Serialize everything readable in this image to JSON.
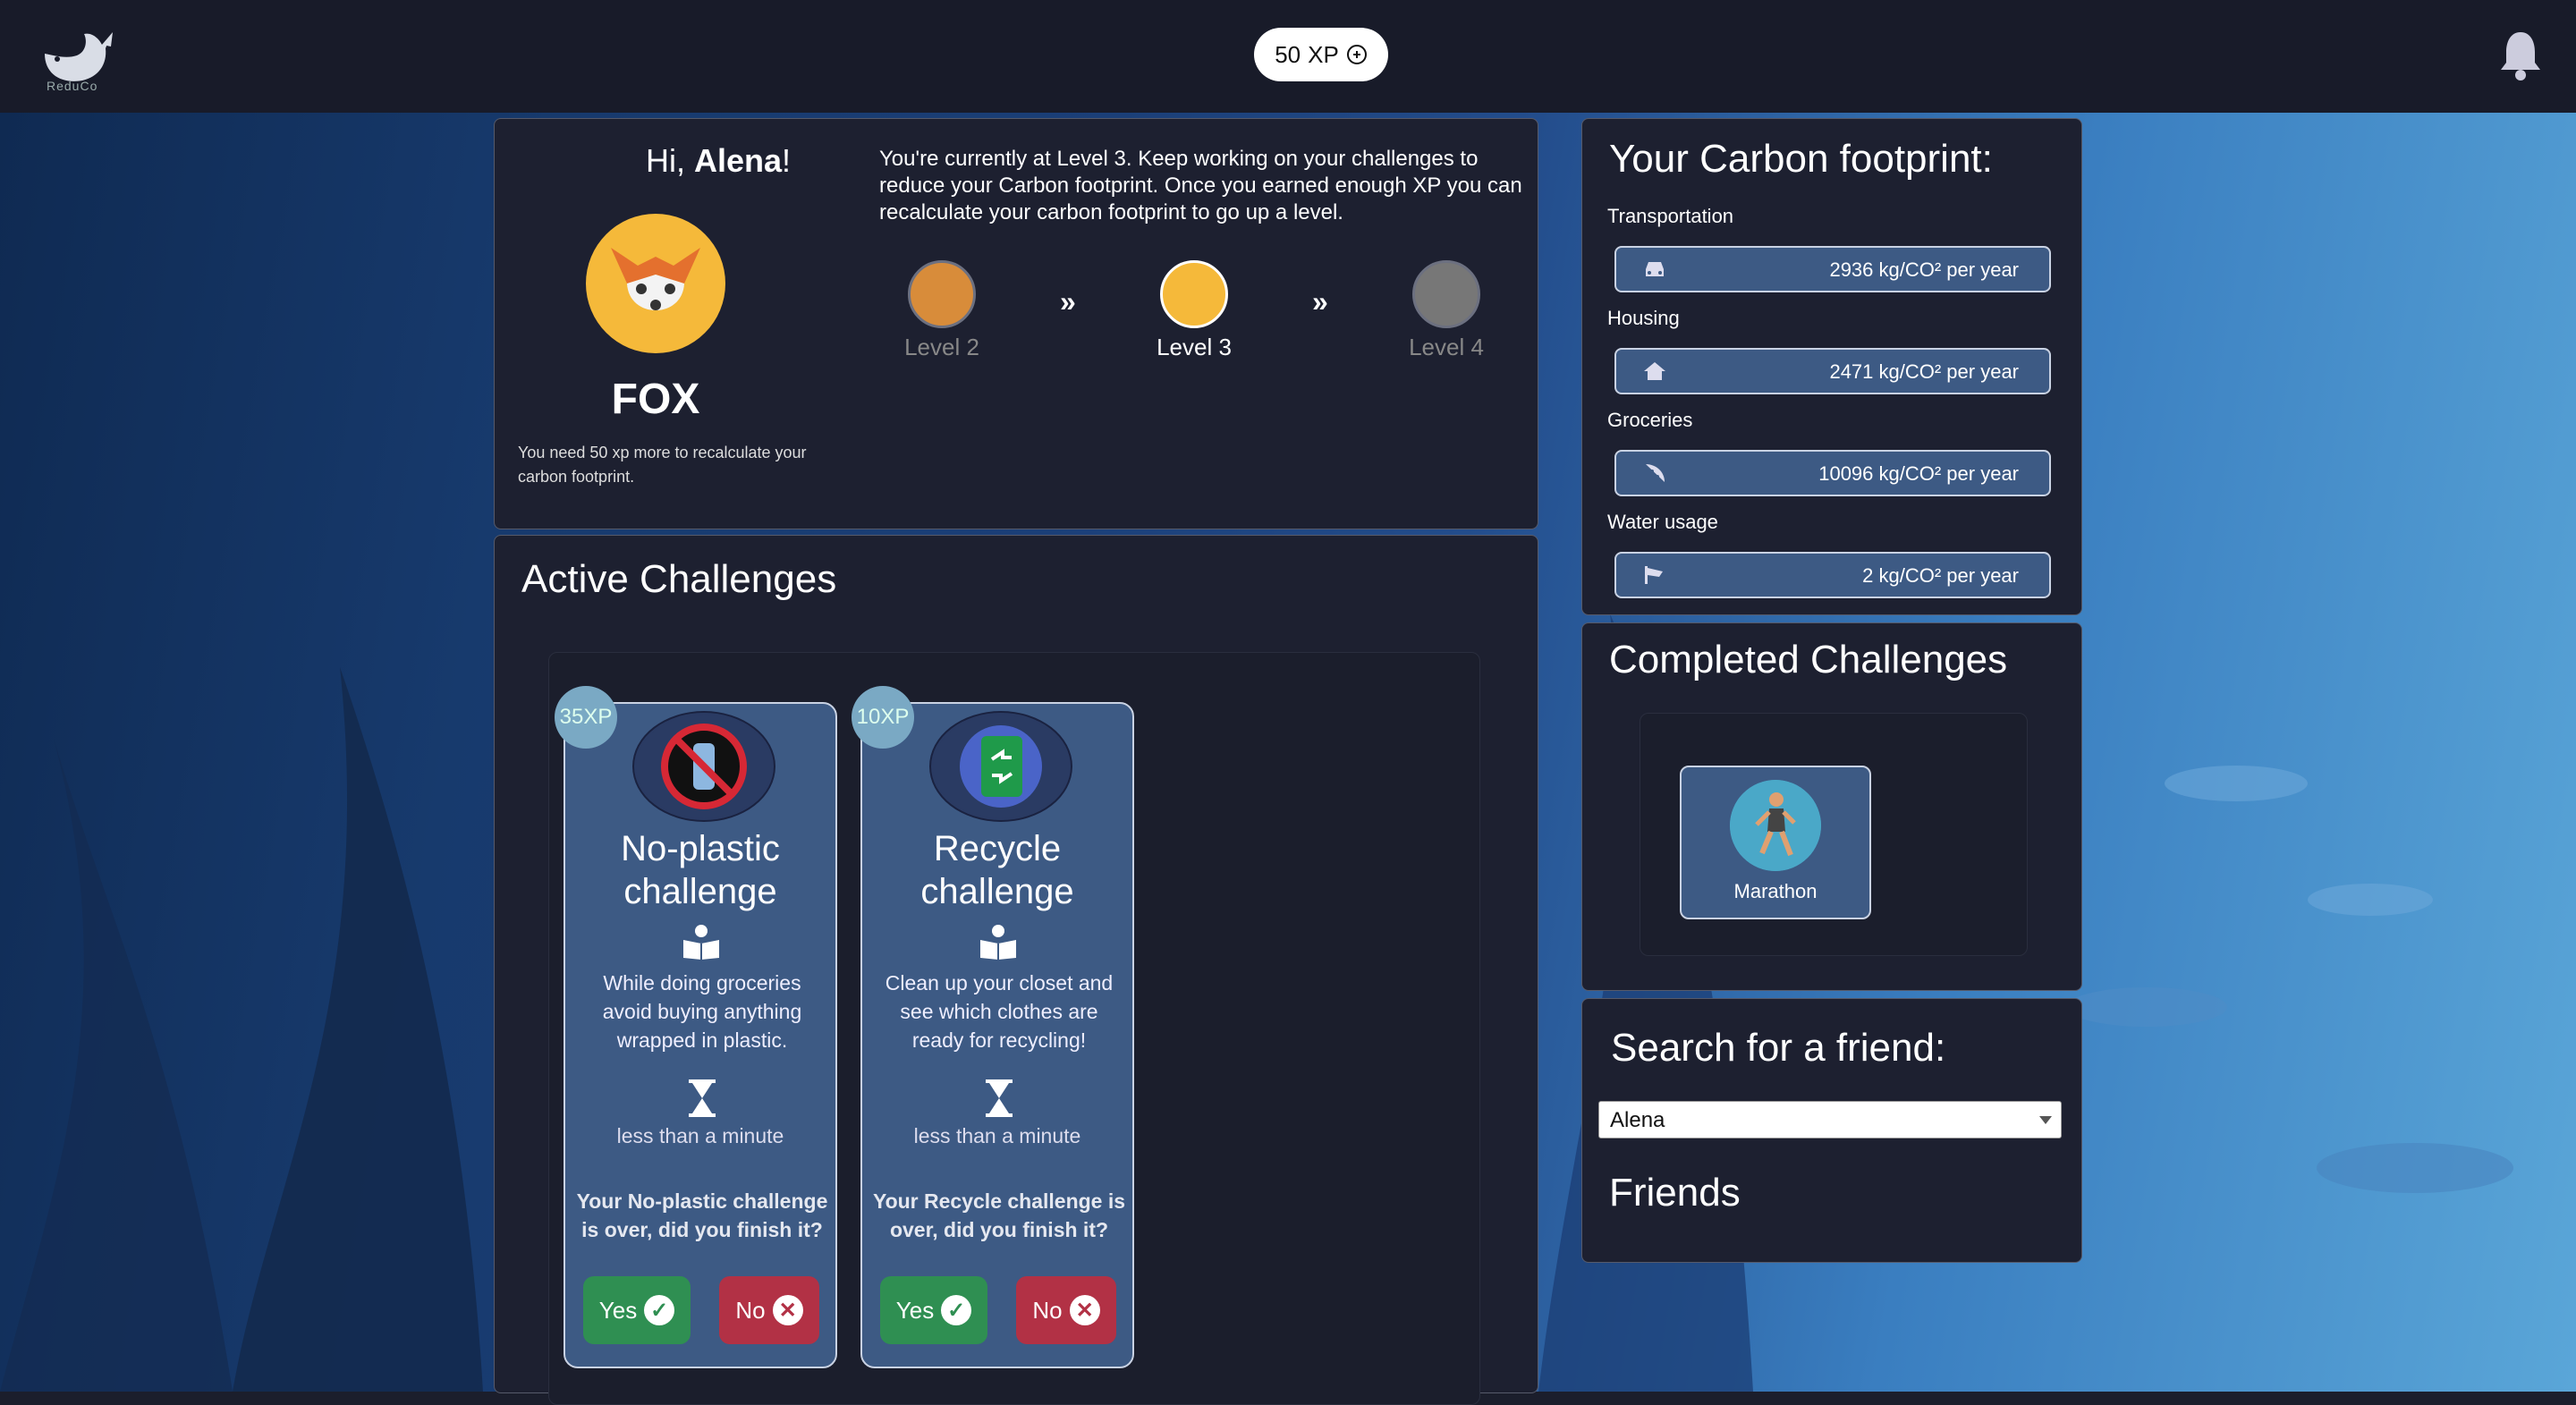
{
  "topbar": {
    "logo_text": "ReduCo",
    "xp_value": "50",
    "xp_unit": "XP",
    "coin_icon": "coin-icon",
    "bell_icon": "bell-icon"
  },
  "profile": {
    "greeting_prefix": "Hi, ",
    "user_name": "Alena",
    "greeting_suffix": "!",
    "animal": "FOX",
    "need_text": "You need 50 xp more to recalculate your carbon footprint.",
    "level_message": "You're currently at Level 3. Keep working on your challenges to reduce your Carbon footprint. Once you earned enough XP you can recalculate your carbon footprint to go up a level.",
    "levels": [
      {
        "label": "Level 2",
        "animal_icon": "lion-icon"
      },
      {
        "label": "Level 3",
        "animal_icon": "fox-icon"
      },
      {
        "label": "Level 4",
        "animal_icon": "gorilla-icon"
      }
    ],
    "arrow": "»"
  },
  "active_challenges": {
    "title": "Active Challenges",
    "cards": [
      {
        "xp": "35XP",
        "title": "No-plastic challenge",
        "description": "While doing groceries avoid buying anything wrapped in plastic.",
        "duration": "less than a minute",
        "question": "Your No-plastic challenge is over, did you finish it?",
        "yes": "Yes",
        "no": "No",
        "icon": "no-plastic-icon"
      },
      {
        "xp": "10XP",
        "title": "Recycle challenge",
        "description": "Clean up your closet and see which clothes are ready for recycling!",
        "duration": "less than a minute",
        "question": "Your Recycle challenge is over, did you finish it?",
        "yes": "Yes",
        "no": "No",
        "icon": "recycle-icon"
      }
    ]
  },
  "footprint": {
    "title": "Your Carbon footprint:",
    "rows": [
      {
        "label": "Transportation",
        "value": "2936 kg/CO² per year",
        "icon": "car-icon"
      },
      {
        "label": "Housing",
        "value": "2471 kg/CO² per year",
        "icon": "house-icon"
      },
      {
        "label": "Groceries",
        "value": "10096 kg/CO² per year",
        "icon": "pizza-icon"
      },
      {
        "label": "Water usage",
        "value": "2 kg/CO² per year",
        "icon": "faucet-icon"
      }
    ]
  },
  "completed": {
    "title": "Completed Challenges",
    "items": [
      {
        "name": "Marathon",
        "icon": "runner-icon"
      }
    ]
  },
  "search": {
    "title": "Search for a friend:",
    "selected": "Alena",
    "friends_title": "Friends"
  },
  "colors": {
    "card_bg": "#3d5a84",
    "yes_green": "#2f8f52",
    "no_red": "#b23145",
    "panel_bg": "#1d2030",
    "badge": "#7aa9c4"
  }
}
